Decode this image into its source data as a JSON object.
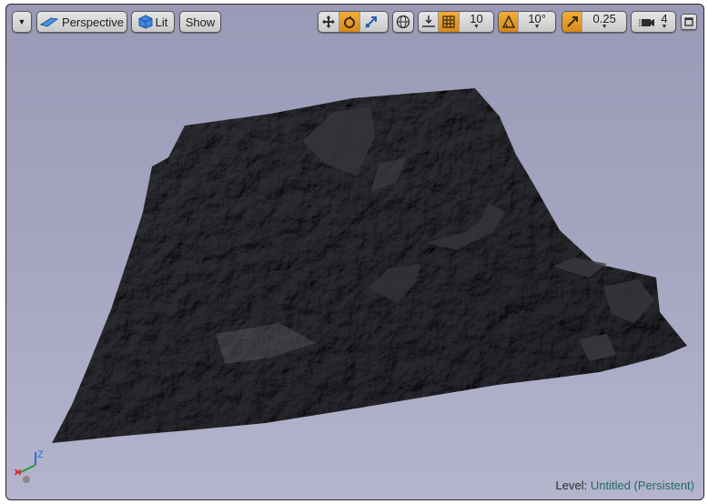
{
  "toolbar": {
    "view_mode_label": "Perspective",
    "lighting_label": "Lit",
    "show_label": "Show",
    "grid_snap_value": "10",
    "rotation_snap_value": "10°",
    "scale_snap_value": "0.25",
    "camera_speed_value": "4"
  },
  "status": {
    "level_key": "Level:",
    "level_value": "Untitled (Persistent)"
  },
  "axis": {
    "x_label": "",
    "z_label": "Z"
  },
  "colors": {
    "accent_orange": "#e49a2a",
    "level_teal": "#1f6b63",
    "terrain_base": "#55565c"
  }
}
